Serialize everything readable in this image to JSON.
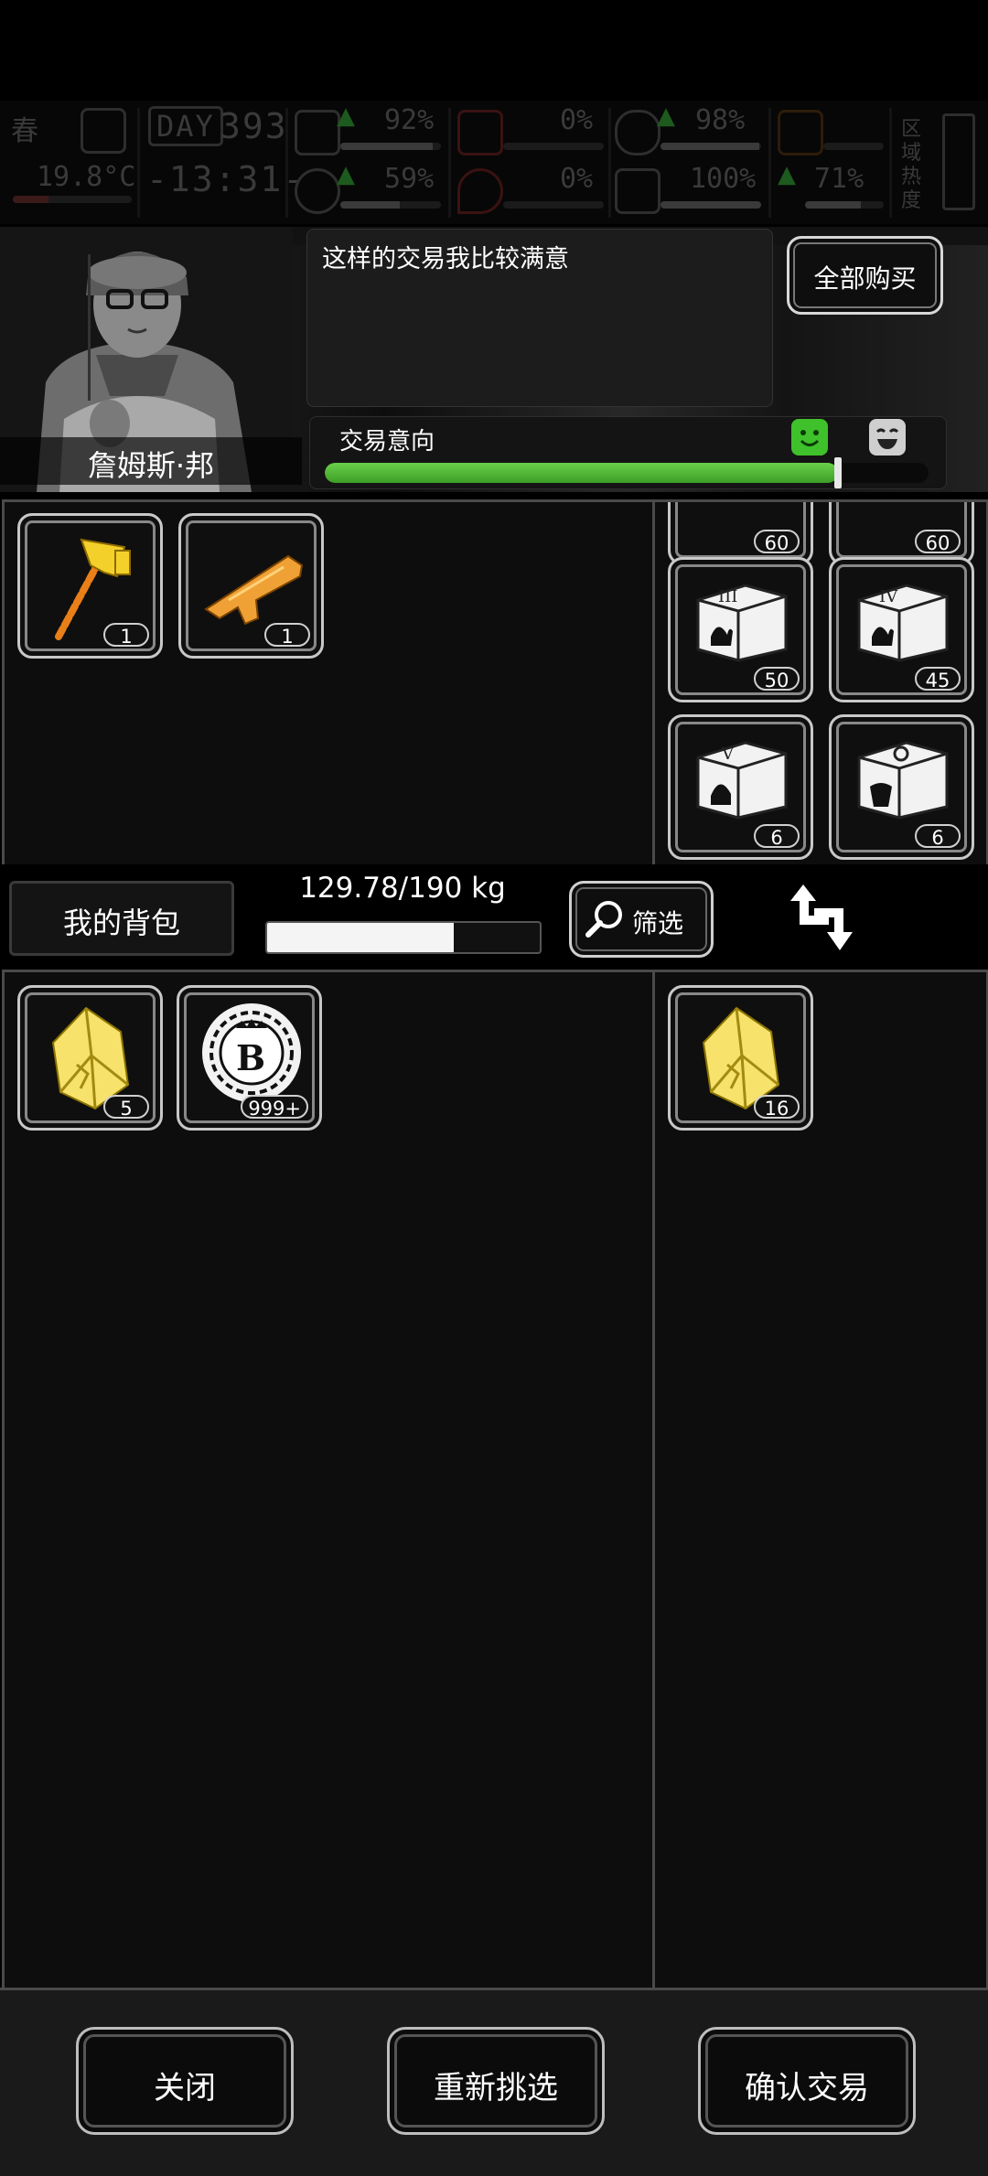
{
  "status": {
    "season": "春",
    "temperature": "19.8°C",
    "day_label": "DAY",
    "day_number": "393",
    "clock": "-13:31-",
    "health_pct": "92%",
    "mental_pct": "59%",
    "bleed_pct": "0%",
    "thirst_pct": "0%",
    "stomach_pct": "98%",
    "heart_pct": "100%",
    "stamina_pct": "71%",
    "region_label": "区域热度"
  },
  "trader": {
    "name": "詹姆斯·邦",
    "dialog": "这样的交易我比较满意",
    "buy_all_label": "全部购买",
    "intent_label": "交易意向",
    "intent_level": 0.85
  },
  "trader_inventory": [
    {
      "name": "golden-hammer",
      "qty": "1"
    },
    {
      "name": "orange-gun",
      "qty": "1"
    }
  ],
  "trade_offer_trader": [
    {
      "name": "crate",
      "qty": "60"
    },
    {
      "name": "crate",
      "qty": "60"
    },
    {
      "name": "crate-iii",
      "qty": "50"
    },
    {
      "name": "crate-iv",
      "qty": "45"
    },
    {
      "name": "crate-v",
      "qty": "6"
    },
    {
      "name": "crate-special",
      "qty": "6"
    }
  ],
  "bag": {
    "label": "我的背包",
    "weight": "129.78/190 kg",
    "weight_fraction": 0.683,
    "filter_label": "筛选"
  },
  "my_inventory": [
    {
      "name": "gold-crystal",
      "qty": "5"
    },
    {
      "name": "b-coin",
      "qty": "999+"
    }
  ],
  "my_offer": [
    {
      "name": "gold-crystal",
      "qty": "16"
    }
  ],
  "buttons": {
    "close": "关闭",
    "reselect": "重新挑选",
    "confirm": "确认交易"
  }
}
